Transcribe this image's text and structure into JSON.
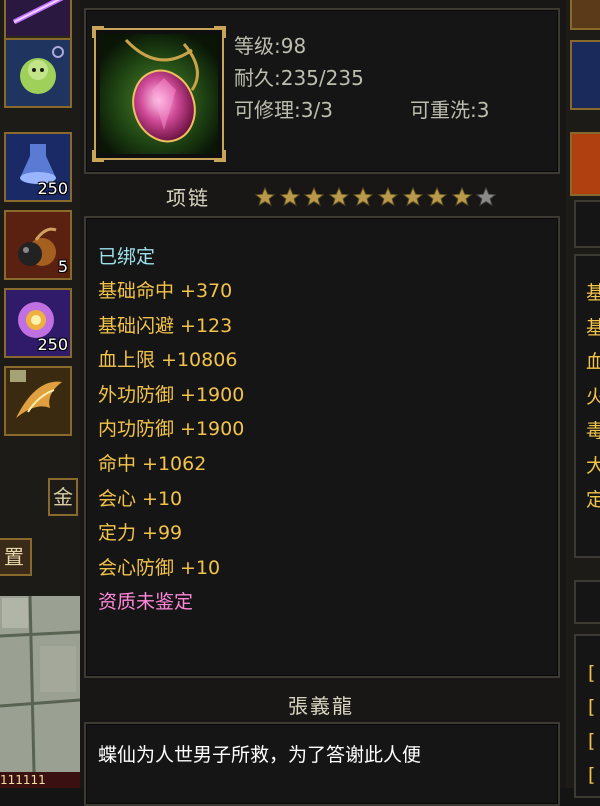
{
  "item": {
    "level_label": "等级:98",
    "durability_label": "耐久:235/235",
    "repair_label": "可修理:3/3",
    "rewash_label": "可重洗:3",
    "name": "项链",
    "stars_filled": 9,
    "stars_total": 10,
    "bound": "已绑定",
    "attributes": [
      {
        "text": "基础命中  +370",
        "color": "#f2c34a"
      },
      {
        "text": "基础闪避  +123",
        "color": "#f2c34a"
      },
      {
        "text": "血上限  +10806",
        "color": "#f2c34a"
      },
      {
        "text": "外功防御  +1900",
        "color": "#f2c34a"
      },
      {
        "text": "内功防御  +1900",
        "color": "#f2c34a"
      },
      {
        "text": "命中  +1062",
        "color": "#f2c34a"
      },
      {
        "text": "会心  +10",
        "color": "#f2c34a"
      },
      {
        "text": "定力  +99",
        "color": "#f2c34a"
      },
      {
        "text": "会心防御  +10",
        "color": "#f2c34a"
      },
      {
        "text": "资质未鉴定",
        "color": "#ff86d8"
      }
    ],
    "maker": "張義龍",
    "description_line1": "蝶仙为人世男子所救，为了答谢此人便"
  },
  "left_sidebar": {
    "slots": [
      {
        "icon": "purple-weapon-icon",
        "qty": ""
      },
      {
        "icon": "green-spirit-icon",
        "qty": ""
      },
      {
        "icon": "blue-potion-icon",
        "qty": "250"
      },
      {
        "icon": "bomb-icon",
        "qty": "5"
      },
      {
        "icon": "purple-orb-icon",
        "qty": "250"
      },
      {
        "icon": "phoenix-icon",
        "qty": ""
      }
    ],
    "btn_gold": "金",
    "btn_set": "置",
    "bottom_numbers": "111111"
  },
  "right_sidebar": {
    "partial_chars": [
      "基",
      "基",
      "血",
      "火",
      "毒",
      "大",
      "定"
    ],
    "brackets": [
      "[",
      "[",
      "[",
      "["
    ]
  },
  "colors": {
    "bound": "#9ee0ec",
    "gold_attr": "#f2c34a",
    "pink": "#ff86d8",
    "border": "#3c3a33"
  }
}
